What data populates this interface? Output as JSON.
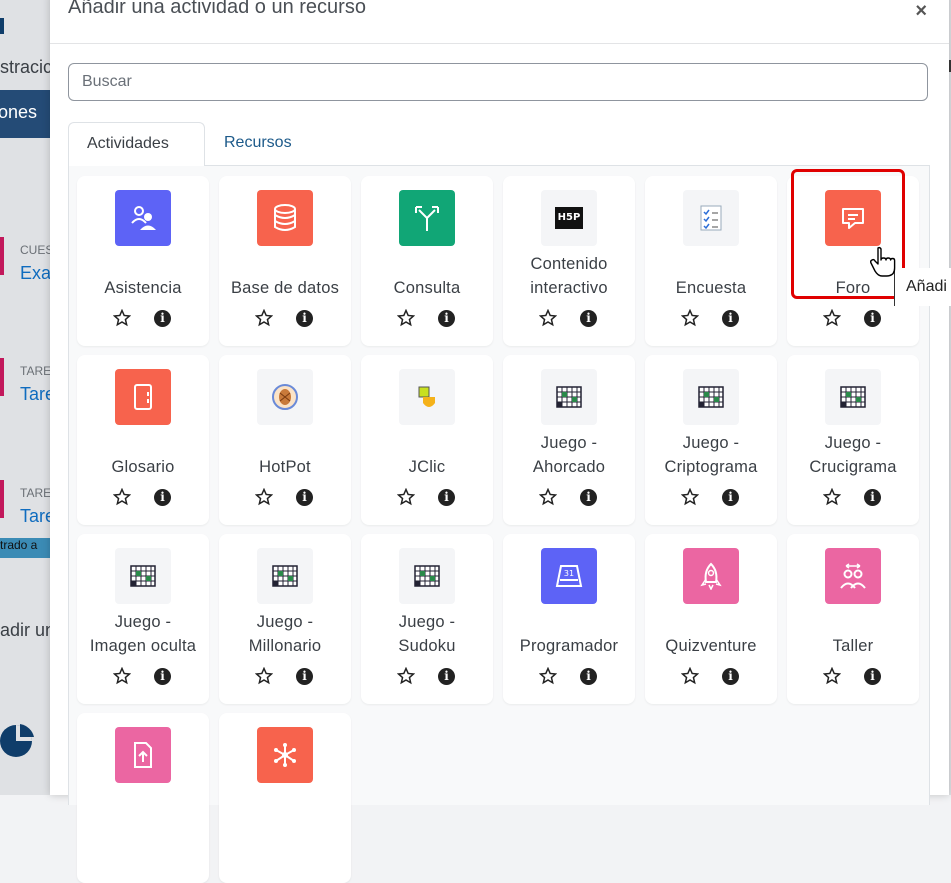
{
  "modal": {
    "title": "Añadir una actividad o un recurso",
    "close": "×",
    "search_placeholder": "Buscar",
    "tabs": [
      {
        "label": "Actividades",
        "active": true
      },
      {
        "label": "Recursos",
        "active": false
      }
    ]
  },
  "background_page": {
    "fragments": [
      "stracic",
      "ones",
      "CUES",
      "Exa",
      "TARE",
      "Tare",
      "TARE",
      "Tare",
      "trado a",
      "adir un"
    ]
  },
  "activities": [
    {
      "name": "Asistencia",
      "icon": "attendance-icon",
      "color": "#5d63f6"
    },
    {
      "name": "Base de datos",
      "icon": "database-icon",
      "color": "#f7634d"
    },
    {
      "name": "Consulta",
      "icon": "choice-icon",
      "color": "#11a676"
    },
    {
      "name_lines": [
        "Contenido",
        "interactivo"
      ],
      "icon": "h5p-icon",
      "color": "#f4f5f7"
    },
    {
      "name": "Encuesta",
      "icon": "survey-icon",
      "color": "#f4f5f7"
    },
    {
      "name": "Foro",
      "icon": "forum-icon",
      "color": "#f7634d"
    },
    {
      "name": "Glosario",
      "icon": "glossary-icon",
      "color": "#f7634d"
    },
    {
      "name": "HotPot",
      "icon": "hotpot-icon",
      "color": "#f4f5f7"
    },
    {
      "name": "JClic",
      "icon": "jclic-icon",
      "color": "#f4f5f7"
    },
    {
      "name_lines": [
        "Juego -",
        "Ahorcado"
      ],
      "icon": "game-icon",
      "color": "#f4f5f7"
    },
    {
      "name_lines": [
        "Juego -",
        "Criptograma"
      ],
      "icon": "game-icon",
      "color": "#f4f5f7"
    },
    {
      "name_lines": [
        "Juego -",
        "Crucigrama"
      ],
      "icon": "game-icon",
      "color": "#f4f5f7"
    },
    {
      "name_lines": [
        "Juego -",
        "Imagen oculta"
      ],
      "icon": "game-icon",
      "color": "#f4f5f7"
    },
    {
      "name_lines": [
        "Juego -",
        "Millonario"
      ],
      "icon": "game-icon",
      "color": "#f4f5f7"
    },
    {
      "name_lines": [
        "Juego -",
        "Sudoku"
      ],
      "icon": "game-icon",
      "color": "#f4f5f7"
    },
    {
      "name": "Programador",
      "icon": "scheduler-icon",
      "color": "#5d63f6"
    },
    {
      "name": "Quizventure",
      "icon": "rocket-icon",
      "color": "#eb66a2"
    },
    {
      "name": "Taller",
      "icon": "workshop-icon",
      "color": "#eb66a2"
    },
    {
      "name": "",
      "icon": "assignment-icon",
      "color": "#eb66a2"
    },
    {
      "name": "",
      "icon": "wiki-icon",
      "color": "#f7634d"
    }
  ],
  "tooltip": "Añadi",
  "highlighted": "Foro"
}
